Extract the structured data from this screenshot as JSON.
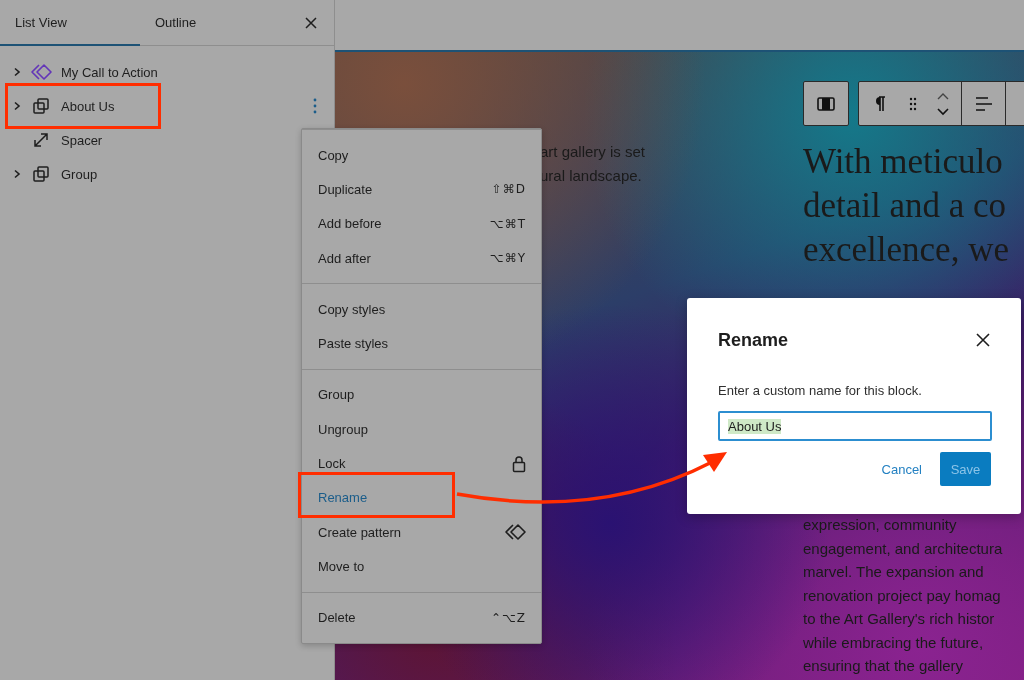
{
  "sidebar": {
    "tabs": [
      {
        "label": "List View",
        "selected": true
      },
      {
        "label": "Outline",
        "selected": false
      }
    ],
    "items": [
      {
        "label": "My Call to Action",
        "kind": "pattern",
        "expandable": true,
        "selected": false
      },
      {
        "label": "About Us",
        "kind": "group",
        "expandable": true,
        "selected": true
      },
      {
        "label": "Spacer",
        "kind": "spacer",
        "expandable": false,
        "selected": false
      },
      {
        "label": "Group",
        "kind": "group",
        "expandable": true,
        "selected": false
      }
    ]
  },
  "canvas": {
    "intro_lines": [
      "art gallery is set",
      "ural landscape."
    ],
    "heading_lines": [
      "With meticulo",
      "detail and a co",
      "excellence, we"
    ],
    "body_lines": [
      "expression, community",
      "engagement, and architectura",
      "marvel. The expansion and",
      "renovation project pay homag",
      "to the Art Gallery's rich histor",
      "while embracing the future,",
      "ensuring that the gallery"
    ]
  },
  "context_menu": {
    "groups": [
      [
        {
          "label": "Copy",
          "kind": "plain",
          "selected": false
        },
        {
          "label": "Duplicate",
          "kind": "plain",
          "shortcut": "⇧⌘D",
          "selected": false
        },
        {
          "label": "Add before",
          "kind": "plain",
          "shortcut": "⌥⌘T",
          "selected": false
        },
        {
          "label": "Add after",
          "kind": "plain",
          "shortcut": "⌥⌘Y",
          "selected": false
        }
      ],
      [
        {
          "label": "Copy styles",
          "kind": "plain",
          "selected": false
        },
        {
          "label": "Paste styles",
          "kind": "plain",
          "selected": false
        }
      ],
      [
        {
          "label": "Group",
          "kind": "plain",
          "selected": false
        },
        {
          "label": "Ungroup",
          "kind": "plain",
          "selected": false
        },
        {
          "label": "Lock",
          "kind": "lock",
          "selected": false
        },
        {
          "label": "Rename",
          "kind": "plain",
          "selected": true
        },
        {
          "label": "Create pattern",
          "kind": "pattern",
          "selected": false
        },
        {
          "label": "Move to",
          "kind": "plain",
          "selected": false
        }
      ],
      [
        {
          "label": "Delete",
          "kind": "plain",
          "shortcut": "⌃⌥Z",
          "selected": false
        }
      ]
    ]
  },
  "dialog": {
    "title": "Rename",
    "label": "Enter a custom name for this block.",
    "input": {
      "value": "About Us",
      "text_selected": true
    },
    "buttons": [
      {
        "label": "Cancel",
        "kind": "link"
      },
      {
        "label": "Save",
        "kind": "primary"
      }
    ]
  }
}
